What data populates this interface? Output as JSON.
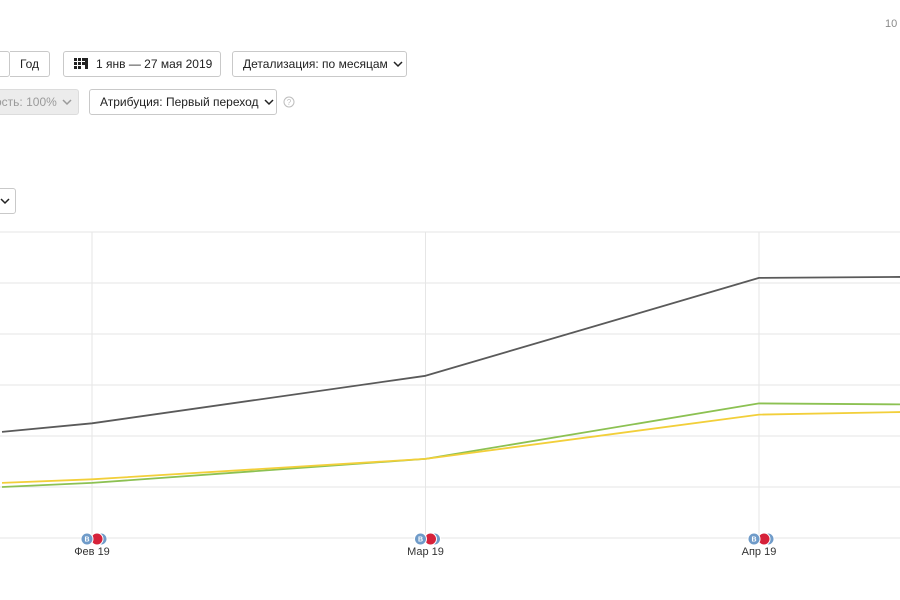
{
  "header": {
    "corner_text": "10"
  },
  "toolbar": {
    "period_year_label": "Год",
    "date_range_label": "1 янв — 27 мая 2019",
    "detail_label": "Детализация: по месяцам",
    "accuracy_label": "ость: 100%",
    "attribution_label": "Атрибуция: Первый переход"
  },
  "icons": {
    "calendar": "calendar-icon",
    "chevron": "chevron-down-icon",
    "help": "help-icon",
    "event_marker": "event-marker-icon"
  },
  "colors": {
    "series_dark": "#5a5a5a",
    "series_green": "#8cc152",
    "series_yellow": "#f2cf3a",
    "marker_blue": "#6f9bc9",
    "marker_red": "#d6223a",
    "grid": "#e6e6e6"
  },
  "chart_data": {
    "type": "line",
    "categories": [
      "Фев 19",
      "Мар 19",
      "Апр 19"
    ],
    "ylim": [
      0,
      6
    ],
    "series": [
      {
        "color": "#5a5a5a",
        "x": [
          -0.27,
          0,
          1,
          2,
          2.43
        ],
        "values": [
          2.08,
          2.25,
          3.18,
          5.1,
          5.12
        ]
      },
      {
        "color": "#8cc152",
        "x": [
          -0.27,
          0,
          1,
          2,
          2.43
        ],
        "values": [
          1.0,
          1.08,
          1.55,
          2.64,
          2.62
        ]
      },
      {
        "color": "#f2cf3a",
        "x": [
          -0.27,
          0,
          1,
          2,
          2.43
        ],
        "values": [
          1.08,
          1.15,
          1.55,
          2.42,
          2.47
        ]
      }
    ],
    "event_markers": [
      {
        "category": "Фев 19",
        "label": "B"
      },
      {
        "category": "Мар 19",
        "label": "B"
      },
      {
        "category": "Апр 19",
        "label": "B"
      }
    ]
  }
}
